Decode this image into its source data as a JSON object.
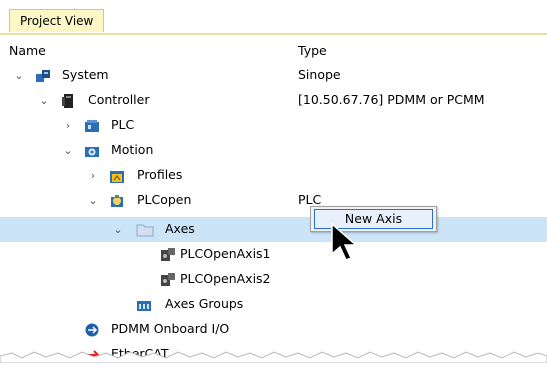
{
  "tab": {
    "label": "Project View"
  },
  "columns": {
    "name": "Name",
    "type": "Type"
  },
  "tree": [
    {
      "label": "System",
      "type": "Sinope",
      "icon": "system-icon",
      "expander": "expanded"
    },
    {
      "label": "Controller",
      "type": "[10.50.67.76] PDMM or PCMM",
      "icon": "controller-icon",
      "expander": "expanded"
    },
    {
      "label": "PLC",
      "type": "",
      "icon": "plc-icon",
      "expander": "collapsed"
    },
    {
      "label": "Motion",
      "type": "",
      "icon": "motion-icon",
      "expander": "expanded"
    },
    {
      "label": "Profiles",
      "type": "",
      "icon": "profiles-icon",
      "expander": "collapsed"
    },
    {
      "label": "PLCopen",
      "type": "PLC",
      "icon": "plcopen-icon",
      "expander": "expanded"
    },
    {
      "label": "Axes",
      "type": "",
      "icon": "folder-icon",
      "expander": "expanded",
      "selected": true
    },
    {
      "label": "PLCOpenAxis1",
      "type": "",
      "icon": "axis-icon"
    },
    {
      "label": "PLCOpenAxis2",
      "type": "",
      "icon": "axis-icon"
    },
    {
      "label": "Axes Groups",
      "type": "",
      "icon": "axes-groups-icon"
    },
    {
      "label": "PDMM Onboard I/O",
      "type": "",
      "icon": "onboard-io-icon"
    },
    {
      "label": "EtherCAT",
      "type": "",
      "icon": "ethercat-icon"
    }
  ],
  "context_menu": {
    "items": [
      {
        "label": "New Axis"
      }
    ]
  }
}
